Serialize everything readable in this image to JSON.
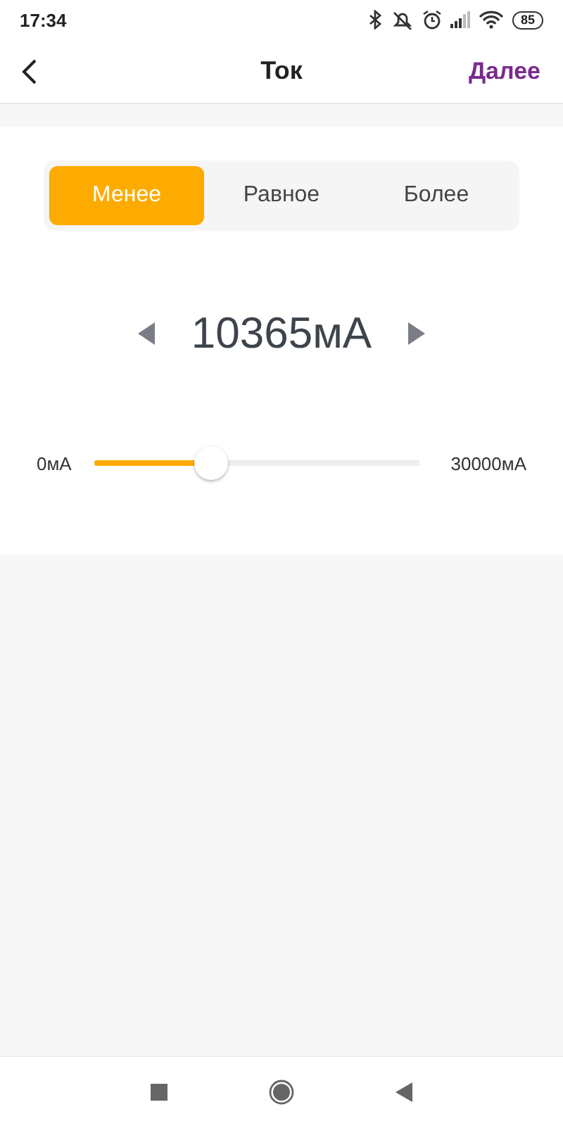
{
  "status_bar": {
    "time": "17:34",
    "battery": "85"
  },
  "header": {
    "title": "Ток",
    "action": "Далее"
  },
  "segments": [
    {
      "label": "Менее",
      "selected": true
    },
    {
      "label": "Равное",
      "selected": false
    },
    {
      "label": "Более",
      "selected": false
    }
  ],
  "value": "10365мА",
  "slider": {
    "min_label": "0мА",
    "max_label": "30000мА",
    "level": 0.345
  }
}
